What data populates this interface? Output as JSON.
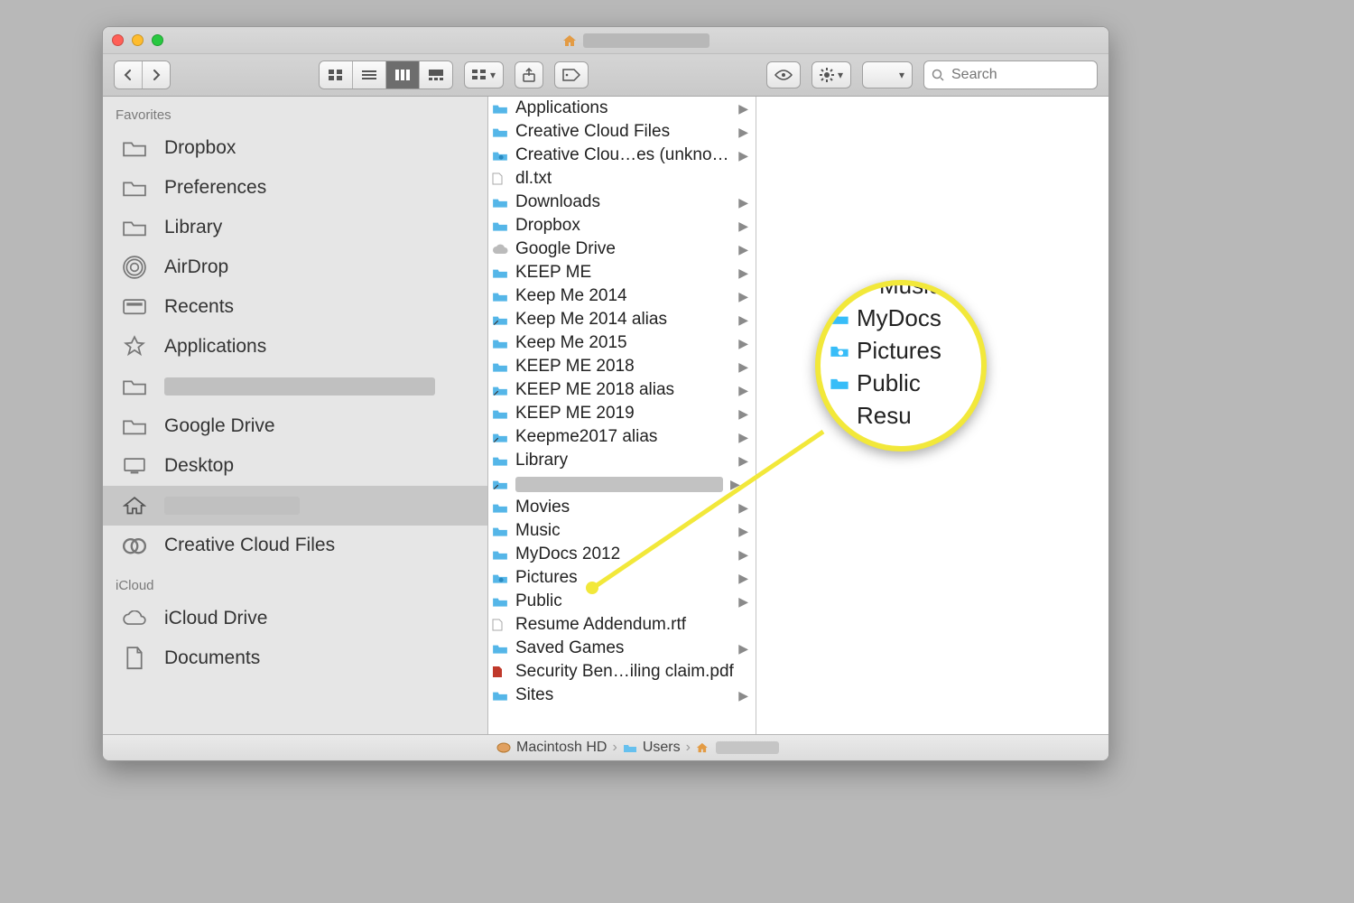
{
  "window": {
    "title_redacted": true
  },
  "toolbar": {
    "search_placeholder": "Search"
  },
  "sidebar": {
    "sections": [
      {
        "label": "Favorites",
        "items": [
          {
            "icon": "folder",
            "label": "Dropbox"
          },
          {
            "icon": "folder",
            "label": "Preferences"
          },
          {
            "icon": "folder",
            "label": "Library"
          },
          {
            "icon": "airdrop",
            "label": "AirDrop"
          },
          {
            "icon": "recents",
            "label": "Recents"
          },
          {
            "icon": "apps",
            "label": "Applications"
          },
          {
            "icon": "folder",
            "label": "",
            "redacted": true
          },
          {
            "icon": "folder",
            "label": "Google Drive"
          },
          {
            "icon": "desktop",
            "label": "Desktop"
          },
          {
            "icon": "home",
            "label": "",
            "redacted": true,
            "selected": true
          },
          {
            "icon": "cc",
            "label": "Creative Cloud Files"
          }
        ]
      },
      {
        "label": "iCloud",
        "items": [
          {
            "icon": "cloud",
            "label": "iCloud Drive"
          },
          {
            "icon": "document",
            "label": "Documents"
          }
        ]
      }
    ]
  },
  "column_items": [
    {
      "icon": "folder",
      "label": "Applications",
      "chev": true
    },
    {
      "icon": "folder",
      "label": "Creative Cloud Files",
      "chev": true
    },
    {
      "icon": "camera",
      "label": "Creative Clou…es (unknown)",
      "chev": true
    },
    {
      "icon": "doc",
      "label": "dl.txt",
      "chev": false
    },
    {
      "icon": "folder",
      "label": "Downloads",
      "chev": true
    },
    {
      "icon": "folder",
      "label": "Dropbox",
      "chev": true
    },
    {
      "icon": "cloud",
      "label": "Google Drive",
      "chev": true
    },
    {
      "icon": "folder",
      "label": "KEEP ME",
      "chev": true
    },
    {
      "icon": "folder",
      "label": "Keep Me 2014",
      "chev": true
    },
    {
      "icon": "alias",
      "label": "Keep Me 2014 alias",
      "chev": true
    },
    {
      "icon": "folder",
      "label": "Keep Me 2015",
      "chev": true
    },
    {
      "icon": "folder",
      "label": "KEEP ME 2018",
      "chev": true
    },
    {
      "icon": "alias",
      "label": "KEEP ME 2018 alias",
      "chev": true
    },
    {
      "icon": "folder",
      "label": "KEEP ME 2019",
      "chev": true
    },
    {
      "icon": "alias",
      "label": "Keepme2017 alias",
      "chev": true
    },
    {
      "icon": "folder",
      "label": "Library",
      "chev": true
    },
    {
      "icon": "alias",
      "label": "",
      "redacted": true,
      "chev": true
    },
    {
      "icon": "folder",
      "label": "Movies",
      "chev": true
    },
    {
      "icon": "folder",
      "label": "Music",
      "chev": true
    },
    {
      "icon": "folder",
      "label": "MyDocs 2012",
      "chev": true
    },
    {
      "icon": "camera",
      "label": "Pictures",
      "chev": true
    },
    {
      "icon": "folder",
      "label": "Public",
      "chev": true
    },
    {
      "icon": "doc",
      "label": "Resume Addendum.rtf",
      "chev": false
    },
    {
      "icon": "folder",
      "label": "Saved Games",
      "chev": true
    },
    {
      "icon": "pdf",
      "label": "Security Ben…iling claim.pdf",
      "chev": false
    },
    {
      "icon": "folder",
      "label": "Sites",
      "chev": true
    }
  ],
  "pathbar": {
    "segments": [
      {
        "icon": "disk",
        "label": "Macintosh HD"
      },
      {
        "icon": "folder",
        "label": "Users"
      },
      {
        "icon": "home",
        "label": "",
        "redacted": true
      }
    ]
  },
  "callout": {
    "rows": [
      {
        "icon": "folder",
        "label": "Music",
        "partial": "top"
      },
      {
        "icon": "folder",
        "label": "MyDocs"
      },
      {
        "icon": "camera",
        "label": "Pictures"
      },
      {
        "icon": "folder",
        "label": "Public"
      },
      {
        "icon": "",
        "label": "Resu",
        "partial": "bottom"
      }
    ]
  }
}
